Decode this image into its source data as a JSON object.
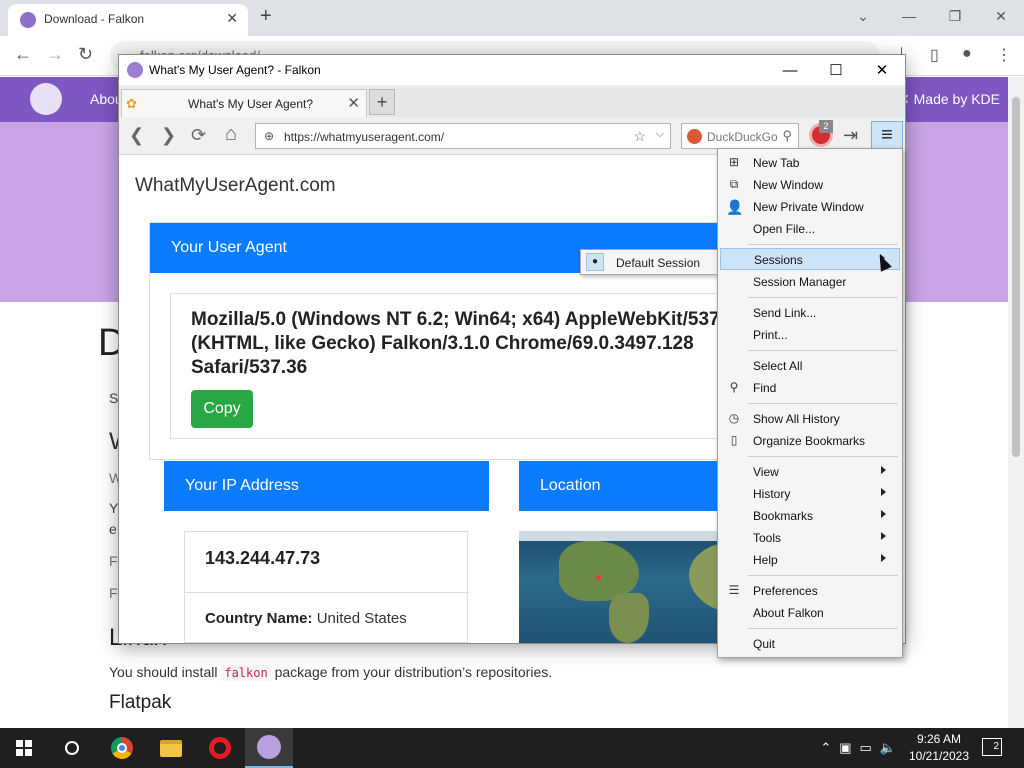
{
  "bg_browser": {
    "tab_title": "Download - Falkon",
    "new_tab": "+",
    "omnibox": "falkon.org/download/",
    "nav_about": "About",
    "made_by": "✕ Made by KDE",
    "fragments": {
      "d": "D",
      "s": "S",
      "w": "W",
      "w2": "W",
      "y": "Y",
      "e": "e",
      "f1": "F",
      "f2": "F"
    },
    "linux_heading": "Linux",
    "install_pre": "You should install ",
    "install_code": "falkon",
    "install_post": " package from your distribution’s repositories.",
    "flatpak_heading": "Flatpak"
  },
  "falkon": {
    "window_title": "What's My User Agent? - Falkon",
    "tab_title": "What's My User Agent?",
    "url": "https://whatmyuseragent.com/",
    "search_placeholder": "DuckDuckGo",
    "adblock_count": "2"
  },
  "page": {
    "brand": "WhatMyUserAgent.com",
    "ua_heading": "Your User Agent",
    "ua_string": "Mozilla/5.0 (Windows NT 6.2; Win64; x64) AppleWebKit/537.36 (KHTML, like Gecko) Falkon/3.1.0 Chrome/69.0.3497.128 Safari/537.36",
    "copy_label": "Copy",
    "ip_heading": "Your IP Address",
    "ip_value": "143.244.47.73",
    "country_label": "Country Name:",
    "country_value": "United States",
    "location_heading": "Location"
  },
  "sessions_submenu": {
    "bullet": "●",
    "item": "Default Session"
  },
  "menu": {
    "new_tab": "New Tab",
    "new_window": "New Window",
    "new_private_window": "New Private Window",
    "open_file": "Open File...",
    "sessions": "Sessions",
    "session_manager": "Session Manager",
    "send_link": "Send Link...",
    "print": "Print...",
    "select_all": "Select All",
    "find": "Find",
    "show_all_history": "Show All History",
    "organize_bookmarks": "Organize Bookmarks",
    "view": "View",
    "history": "History",
    "bookmarks": "Bookmarks",
    "tools": "Tools",
    "help": "Help",
    "preferences": "Preferences",
    "about_falkon": "About Falkon",
    "quit": "Quit"
  },
  "taskbar": {
    "time": "9:26 AM",
    "date": "10/21/2023",
    "notifications": "2"
  },
  "colors": {
    "falkon_purple": "#7e57c2",
    "card_blue": "#0b7bff",
    "copy_green": "#28a745",
    "menu_highlight": "#cde3f7"
  }
}
